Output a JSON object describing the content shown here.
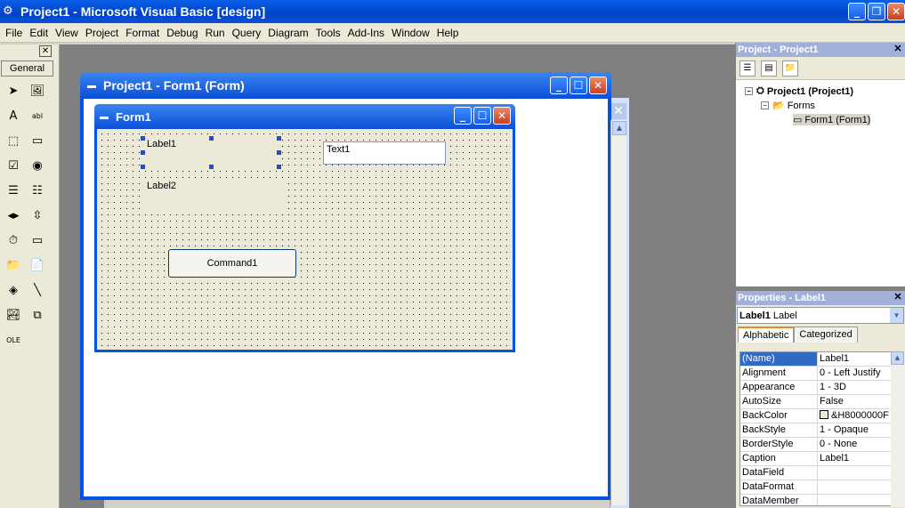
{
  "window": {
    "title": "Project1 - Microsoft Visual Basic [design]",
    "min": "_",
    "restore": "❐",
    "close": "✕"
  },
  "menu": [
    "File",
    "Edit",
    "View",
    "Project",
    "Format",
    "Debug",
    "Run",
    "Query",
    "Diagram",
    "Tools",
    "Add-Ins",
    "Window",
    "Help"
  ],
  "toolbox": {
    "close": "✕",
    "tab": "General",
    "tools": [
      {
        "name": "pointer-icon",
        "glyph": "➤"
      },
      {
        "name": "picturebox-icon",
        "glyph": "🖼"
      },
      {
        "name": "label-icon",
        "glyph": "A"
      },
      {
        "name": "textbox-icon",
        "glyph": "abl"
      },
      {
        "name": "frame-icon",
        "glyph": "⬚"
      },
      {
        "name": "commandbutton-icon",
        "glyph": "▭"
      },
      {
        "name": "checkbox-icon",
        "glyph": "☑"
      },
      {
        "name": "optionbutton-icon",
        "glyph": "◉"
      },
      {
        "name": "combobox-icon",
        "glyph": "☰"
      },
      {
        "name": "listbox-icon",
        "glyph": "☷"
      },
      {
        "name": "hscrollbar-icon",
        "glyph": "◂▸"
      },
      {
        "name": "vscrollbar-icon",
        "glyph": "⇳"
      },
      {
        "name": "timer-icon",
        "glyph": "⏱"
      },
      {
        "name": "drivelist-icon",
        "glyph": "▭"
      },
      {
        "name": "dirlist-icon",
        "glyph": "📁"
      },
      {
        "name": "filelist-icon",
        "glyph": "📄"
      },
      {
        "name": "shape-icon",
        "glyph": "◈"
      },
      {
        "name": "line-icon",
        "glyph": "╲"
      },
      {
        "name": "image-icon",
        "glyph": "🏞"
      },
      {
        "name": "data-icon",
        "glyph": "⧉"
      },
      {
        "name": "ole-icon",
        "glyph": "OLE"
      }
    ]
  },
  "designer": {
    "title": "Project1 - Form1 (Form)",
    "form_title": "Form1",
    "label1": "Label1",
    "label2": "Label2",
    "text1": "Text1",
    "command1": "Command1"
  },
  "project": {
    "title": "Project - Project1",
    "close": "✕",
    "root": "Project1 (Project1)",
    "folder": "Forms",
    "form": "Form1 (Form1)"
  },
  "properties": {
    "title": "Properties - Label1",
    "close": "✕",
    "object_name": "Label1",
    "object_type": "Label",
    "tabs": [
      "Alphabetic",
      "Categorized"
    ],
    "rows": [
      {
        "name": "(Name)",
        "value": "Label1"
      },
      {
        "name": "Alignment",
        "value": "0 - Left Justify"
      },
      {
        "name": "Appearance",
        "value": "1 - 3D"
      },
      {
        "name": "AutoSize",
        "value": "False"
      },
      {
        "name": "BackColor",
        "value": "&H8000000F"
      },
      {
        "name": "BackStyle",
        "value": "1 - Opaque"
      },
      {
        "name": "BorderStyle",
        "value": "0 - None"
      },
      {
        "name": "Caption",
        "value": "Label1"
      },
      {
        "name": "DataField",
        "value": ""
      },
      {
        "name": "DataFormat",
        "value": ""
      },
      {
        "name": "DataMember",
        "value": ""
      }
    ]
  }
}
